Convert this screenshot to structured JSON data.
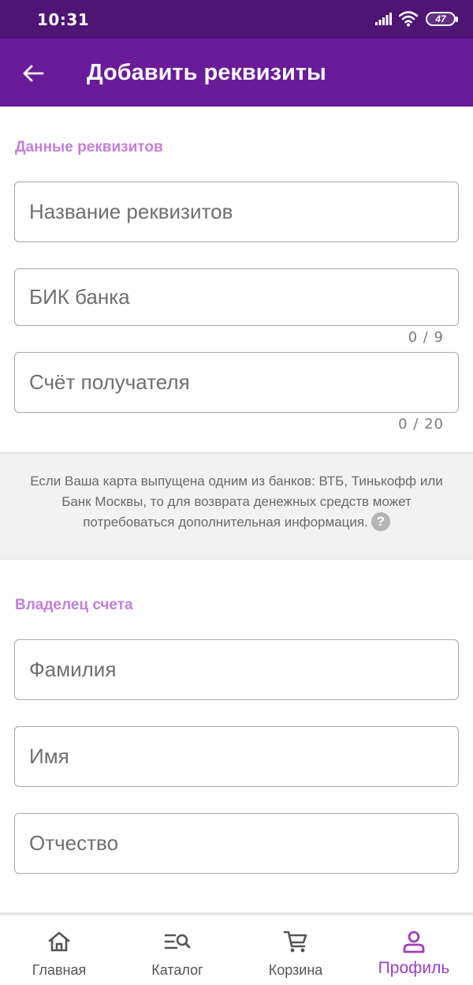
{
  "status_bar": {
    "time": "10:31",
    "battery": "47",
    "icons": [
      "signal-icon",
      "wifi-icon",
      "battery-icon"
    ]
  },
  "app_bar": {
    "title": "Добавить реквизиты",
    "back_icon": "arrow-left-icon"
  },
  "colors": {
    "status_bar": "#4e1575",
    "app_bar": "#6a1b9a",
    "section_label": "#c47fd8",
    "active_nav": "#9c3fbf"
  },
  "requisites": {
    "section_label": "Данные реквизитов",
    "name_field": {
      "placeholder": "Название реквизитов",
      "value": ""
    },
    "bik_field": {
      "placeholder": "БИК банка",
      "value": "",
      "counter": "0 / 9"
    },
    "account_field": {
      "placeholder": "Счёт получателя",
      "value": "",
      "counter": "0 / 20"
    }
  },
  "info": {
    "text": "Если Ваша карта выпущена одним из банков: ВТБ, Тинькофф или Банк Москвы, то для возврата денежных средств может потребоваться дополнительная информация.",
    "help_icon": "?"
  },
  "owner": {
    "section_label": "Владелец счета",
    "last_name_field": {
      "placeholder": "Фамилия",
      "value": ""
    },
    "first_name_field": {
      "placeholder": "Имя",
      "value": ""
    },
    "patronymic_field": {
      "placeholder": "Отчество",
      "value": ""
    }
  },
  "bottom_nav": {
    "items": [
      {
        "label": "Главная",
        "icon": "home-icon",
        "active": false
      },
      {
        "label": "Каталог",
        "icon": "catalog-search-icon",
        "active": false
      },
      {
        "label": "Корзина",
        "icon": "cart-icon",
        "active": false
      },
      {
        "label": "Профиль",
        "icon": "profile-icon",
        "active": true
      }
    ]
  }
}
